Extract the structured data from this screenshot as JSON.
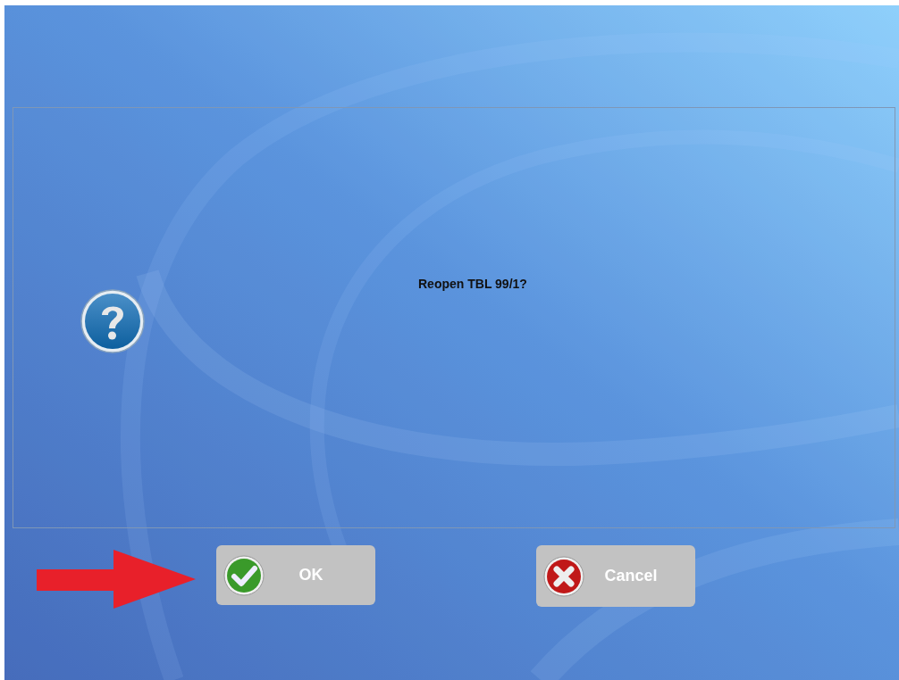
{
  "dialog": {
    "kind": "question",
    "message": "Reopen TBL 99/1?"
  },
  "buttons": [
    {
      "kind": "ok",
      "label": "OK"
    },
    {
      "kind": "cancel",
      "label": "Cancel"
    }
  ],
  "annotation": {
    "kind": "arrow"
  }
}
